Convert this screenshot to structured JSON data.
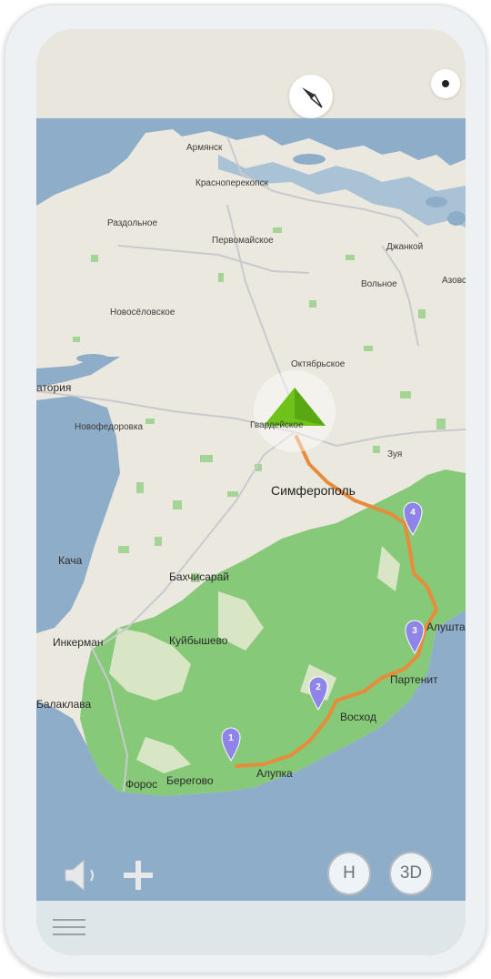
{
  "map": {
    "labels": {
      "armyansk": "Армянск",
      "krasnoperekopsk": "Красноперекопск",
      "razdolnoe": "Раздольное",
      "pervomaiskoe": "Первомайское",
      "dzhankoi": "Джанкой",
      "volnoe": "Вольное",
      "azovs": "Азовс",
      "novoselovskoe": "Новосёловское",
      "oktyabrskoe": "Октябрьское",
      "evpatoriya": "атория",
      "novofedorovka": "Новофедоровка",
      "gvardeiskoe": "Гвардейское",
      "zuya": "Зуя",
      "simferopol": "Симферополь",
      "kacha": "Кача",
      "bakhchisarai": "Бахчисарай",
      "alushta": "Алушта",
      "inkerman": "Инкерман",
      "kuibyshevo": "Куйбышево",
      "partenit": "Партенит",
      "balaklava": "Балаклава",
      "voskhod": "Восход",
      "alupka": "Алупка",
      "foros": "Форос",
      "beregovoe": "Берегово"
    },
    "markers": [
      "1",
      "2",
      "3",
      "4"
    ]
  },
  "controls": {
    "north_label": "Н",
    "view_3d_label": "3D"
  },
  "icons": {
    "compass": "compass-icon",
    "dot": "location-dot-icon",
    "sound": "speaker-icon",
    "plus": "plus-icon",
    "menu": "hamburger-menu-icon",
    "arrow": "navigation-arrow-icon"
  },
  "colors": {
    "water": "#8eadc9",
    "land": "#ebe8df",
    "forest": "#86c978",
    "route": "#e88b3a",
    "arrow": "#6ec21a",
    "marker": "#8f85e8"
  }
}
